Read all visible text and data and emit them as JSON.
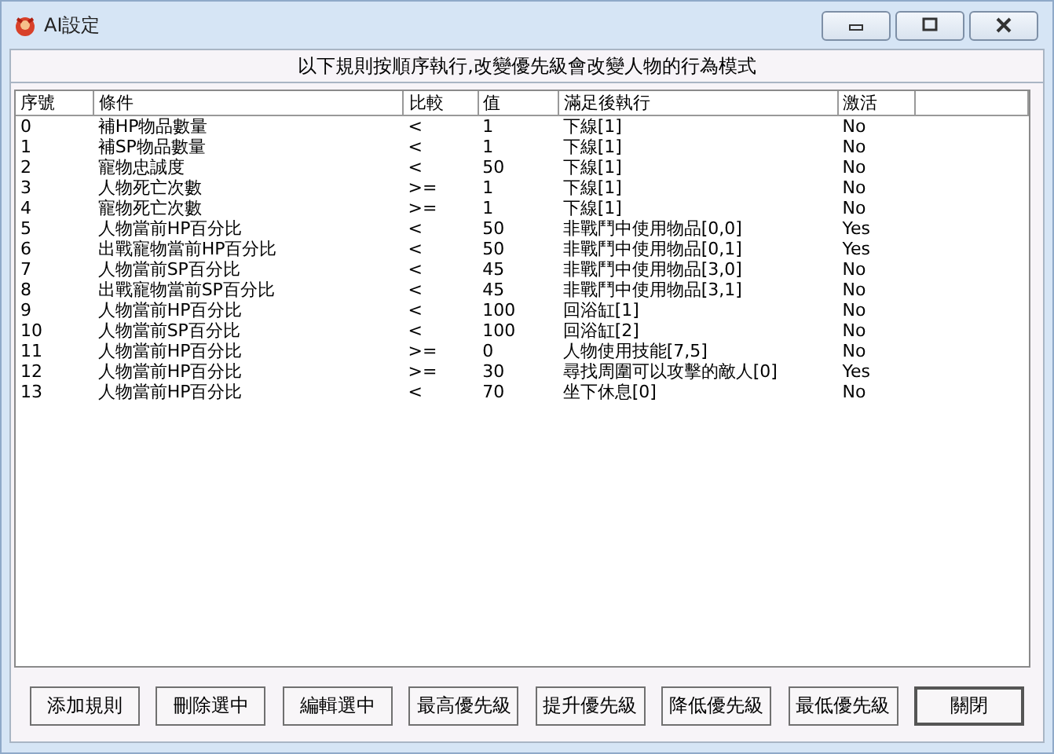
{
  "window": {
    "title": "AI設定"
  },
  "notice": "以下規則按順序執行,改變優先級會改變人物的行為模式",
  "table": {
    "columns": [
      "序號",
      "條件",
      "比較",
      "值",
      "滿足後執行",
      "激活"
    ],
    "rows": [
      [
        "0",
        "補HP物品數量",
        "<",
        "1",
        "下線[1]",
        "No"
      ],
      [
        "1",
        "補SP物品數量",
        "<",
        "1",
        "下線[1]",
        "No"
      ],
      [
        "2",
        "寵物忠誠度",
        "<",
        "50",
        "下線[1]",
        "No"
      ],
      [
        "3",
        "人物死亡次數",
        ">=",
        "1",
        "下線[1]",
        "No"
      ],
      [
        "4",
        "寵物死亡次數",
        ">=",
        "1",
        "下線[1]",
        "No"
      ],
      [
        "5",
        "人物當前HP百分比",
        "<",
        "50",
        "非戰鬥中使用物品[0,0]",
        "Yes"
      ],
      [
        "6",
        "出戰寵物當前HP百分比",
        "<",
        "50",
        "非戰鬥中使用物品[0,1]",
        "Yes"
      ],
      [
        "7",
        "人物當前SP百分比",
        "<",
        "45",
        "非戰鬥中使用物品[3,0]",
        "No"
      ],
      [
        "8",
        "出戰寵物當前SP百分比",
        "<",
        "45",
        "非戰鬥中使用物品[3,1]",
        "No"
      ],
      [
        "9",
        "人物當前HP百分比",
        "<",
        "100",
        "回浴缸[1]",
        "No"
      ],
      [
        "10",
        "人物當前SP百分比",
        "<",
        "100",
        "回浴缸[2]",
        "No"
      ],
      [
        "11",
        "人物當前HP百分比",
        ">=",
        "0",
        "人物使用技能[7,5]",
        "No"
      ],
      [
        "12",
        "人物當前HP百分比",
        ">=",
        "30",
        "尋找周圍可以攻擊的敵人[0]",
        "Yes"
      ],
      [
        "13",
        "人物當前HP百分比",
        "<",
        "70",
        "坐下休息[0]",
        "No"
      ]
    ]
  },
  "buttons": [
    "添加規則",
    "刪除選中",
    "編輯選中",
    "最高優先級",
    "提升優先級",
    "降低優先級",
    "最低優先級",
    "關閉"
  ]
}
